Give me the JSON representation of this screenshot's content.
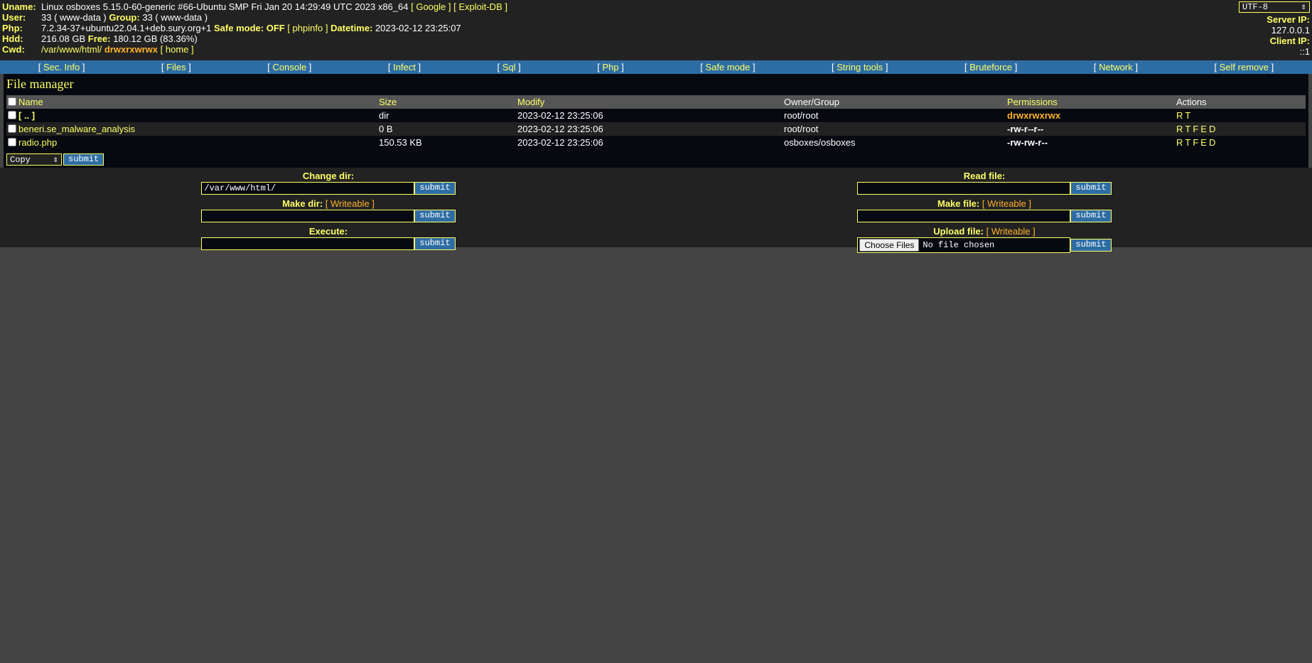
{
  "header": {
    "uname_label": "Uname:",
    "uname_value": "Linux osboxes 5.15.0-60-generic #66-Ubuntu SMP Fri Jan 20 14:29:49 UTC 2023 x86_64",
    "google_link": "[ Google ]",
    "exploitdb_link": "[ Exploit-DB ]",
    "user_label": "User:",
    "user_value": "33 ( www-data )",
    "group_label": "Group:",
    "group_value": "33 ( www-data )",
    "php_label": "Php:",
    "php_value": "7.2.34-37+ubuntu22.04.1+deb.sury.org+1",
    "safemode_label": "Safe mode:",
    "safemode_value": "OFF",
    "phpinfo_link": "[ phpinfo ]",
    "datetime_label": "Datetime:",
    "datetime_value": "2023-02-12 23:25:07",
    "hdd_label": "Hdd:",
    "hdd_value": "216.08 GB",
    "free_label": "Free:",
    "free_value": "180.12 GB (83.36%)",
    "cwd_label": "Cwd:",
    "cwd_value": "/var/www/html/",
    "cwd_perms": "drwxrxwrwx",
    "home_link": "[ home ]",
    "charset": "UTF-8",
    "server_ip_label": "Server IP:",
    "server_ip": "127.0.0.1",
    "client_ip_label": "Client IP:",
    "client_ip": "::1"
  },
  "menu": [
    "Sec. Info",
    "Files",
    "Console",
    "Infect",
    "Sql",
    "Php",
    "Safe mode",
    "String tools",
    "Bruteforce",
    "Network",
    "Self remove"
  ],
  "file_manager": {
    "title": "File manager",
    "columns": [
      "Name",
      "Size",
      "Modify",
      "Owner/Group",
      "Permissions",
      "Actions"
    ],
    "rows": [
      {
        "name": "[ .. ]",
        "size": "dir",
        "modify": "2023-02-12 23:25:06",
        "owner": "root/root",
        "perms": "drwxrwxrwx",
        "actions": [
          "R",
          "T"
        ]
      },
      {
        "name": "beneri.se_malware_analysis",
        "size": "0 B",
        "modify": "2023-02-12 23:25:06",
        "owner": "root/root",
        "perms": "-rw-r--r--",
        "actions": [
          "R",
          "T",
          "F",
          "E",
          "D"
        ]
      },
      {
        "name": "radio.php",
        "size": "150.53 KB",
        "modify": "2023-02-12 23:25:06",
        "owner": "osboxes/osboxes",
        "perms": "-rw-rw-r--",
        "actions": [
          "R",
          "T",
          "F",
          "E",
          "D"
        ]
      }
    ],
    "bulk_select": "Copy",
    "submit": "submit"
  },
  "forms": {
    "change_dir_label": "Change dir:",
    "change_dir_value": "/var/www/html/",
    "make_dir_label": "Make dir:",
    "writeable": "[ Writeable ]",
    "execute_label": "Execute:",
    "read_file_label": "Read file:",
    "make_file_label": "Make file:",
    "upload_file_label": "Upload file:",
    "choose_files": "Choose Files",
    "no_file": "No file chosen",
    "submit": "submit"
  },
  "colors": {
    "accent_yellow": "#ffff66",
    "orange": "#ffb22a",
    "menu_blue": "#2e6da4",
    "background": "#444444"
  }
}
